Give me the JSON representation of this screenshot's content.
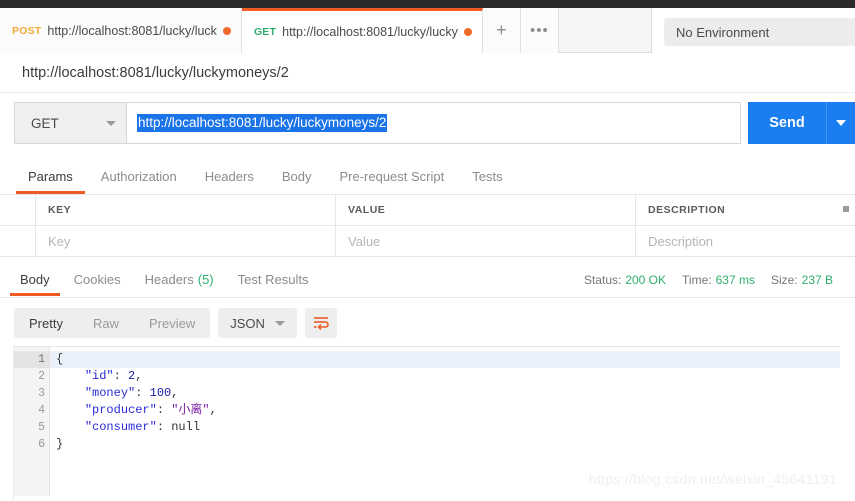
{
  "window": {
    "environment_label": "No Environment"
  },
  "tabs": [
    {
      "method": "POST",
      "url": "http://localhost:8081/lucky/luck",
      "unsaved": true,
      "active": false
    },
    {
      "method": "GET",
      "url": "http://localhost:8081/lucky/lucky",
      "unsaved": true,
      "active": true
    }
  ],
  "tab_controls": {
    "new_tab": "+",
    "more": "•••"
  },
  "request": {
    "name": "http://localhost:8081/lucky/luckymoneys/2",
    "method": "GET",
    "url": "http://localhost:8081/lucky/luckymoneys/2",
    "send_label": "Send"
  },
  "request_tabs": [
    {
      "label": "Params",
      "active": true
    },
    {
      "label": "Authorization",
      "active": false
    },
    {
      "label": "Headers",
      "active": false
    },
    {
      "label": "Body",
      "active": false
    },
    {
      "label": "Pre-request Script",
      "active": false
    },
    {
      "label": "Tests",
      "active": false
    }
  ],
  "params_table": {
    "headers": [
      "KEY",
      "VALUE",
      "DESCRIPTION"
    ],
    "placeholder_row": [
      "Key",
      "Value",
      "Description"
    ]
  },
  "response_tabs": [
    {
      "label": "Body",
      "count": "",
      "active": true
    },
    {
      "label": "Cookies",
      "count": "",
      "active": false
    },
    {
      "label": "Headers",
      "count": "(5)",
      "active": false
    },
    {
      "label": "Test Results",
      "count": "",
      "active": false
    }
  ],
  "response_meta": {
    "status_label": "Status:",
    "status_value": "200 OK",
    "time_label": "Time:",
    "time_value": "637 ms",
    "size_label": "Size:",
    "size_value": "237 B"
  },
  "body_toolbar": {
    "views": [
      {
        "label": "Pretty",
        "active": true
      },
      {
        "label": "Raw",
        "active": false
      },
      {
        "label": "Preview",
        "active": false
      }
    ],
    "format": "JSON",
    "wrap_icon": "word-wrap-icon"
  },
  "response_body": {
    "language": "json",
    "lines": [
      {
        "n": "1",
        "segments": [
          {
            "t": "{",
            "c": "k-punct"
          }
        ]
      },
      {
        "n": "2",
        "segments": [
          {
            "t": "    ",
            "c": "k-punct"
          },
          {
            "t": "\"id\"",
            "c": "k-str"
          },
          {
            "t": ": ",
            "c": "k-punct"
          },
          {
            "t": "2",
            "c": "k-num"
          },
          {
            "t": ",",
            "c": "k-punct"
          }
        ]
      },
      {
        "n": "3",
        "segments": [
          {
            "t": "    ",
            "c": "k-punct"
          },
          {
            "t": "\"money\"",
            "c": "k-str"
          },
          {
            "t": ": ",
            "c": "k-punct"
          },
          {
            "t": "100",
            "c": "k-num"
          },
          {
            "t": ",",
            "c": "k-punct"
          }
        ]
      },
      {
        "n": "4",
        "segments": [
          {
            "t": "    ",
            "c": "k-punct"
          },
          {
            "t": "\"producer\"",
            "c": "k-str"
          },
          {
            "t": ": ",
            "c": "k-punct"
          },
          {
            "t": "\"小离\"",
            "c": "k-val"
          },
          {
            "t": ",",
            "c": "k-punct"
          }
        ]
      },
      {
        "n": "5",
        "segments": [
          {
            "t": "    ",
            "c": "k-punct"
          },
          {
            "t": "\"consumer\"",
            "c": "k-str"
          },
          {
            "t": ": ",
            "c": "k-punct"
          },
          {
            "t": "null",
            "c": "k-null"
          }
        ]
      },
      {
        "n": "6",
        "segments": [
          {
            "t": "}",
            "c": "k-punct"
          }
        ]
      }
    ],
    "raw_text": "{\n    \"id\": 2,\n    \"money\": 100,\n    \"producer\": \"小离\",\n    \"consumer\": null\n}"
  },
  "watermark": "https://blog.csdn.net/weixin_45641191",
  "colors": {
    "accent_orange": "#ef5b25",
    "send_blue": "#1a7ef0",
    "selection_blue": "#1a73e8",
    "success_green": "#2fae6d",
    "post_amber": "#f2a93b"
  }
}
